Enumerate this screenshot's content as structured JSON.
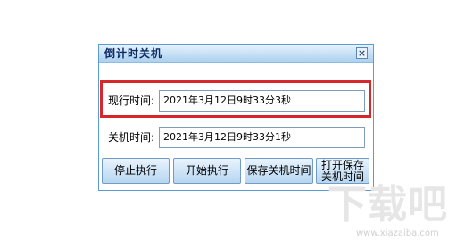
{
  "window": {
    "title": "倒计时关机",
    "close_label": "×"
  },
  "fields": {
    "current_time_label": "现行时间:",
    "current_time_value": "2021年3月12日9时33分3秒",
    "shutdown_time_label": "关机时间:",
    "shutdown_time_value": "2021年3月12日9时33分1秒"
  },
  "buttons": {
    "stop": "停止执行",
    "start": "开始执行",
    "save": "保存关机时间",
    "open_saved": "打开保存关机时间"
  },
  "watermark": {
    "text": "下载吧",
    "url": "www.xiazaiba.com"
  },
  "colors": {
    "highlight_border": "#d7272b",
    "title_text": "#0b2a66",
    "window_border": "#5a9bd3"
  }
}
